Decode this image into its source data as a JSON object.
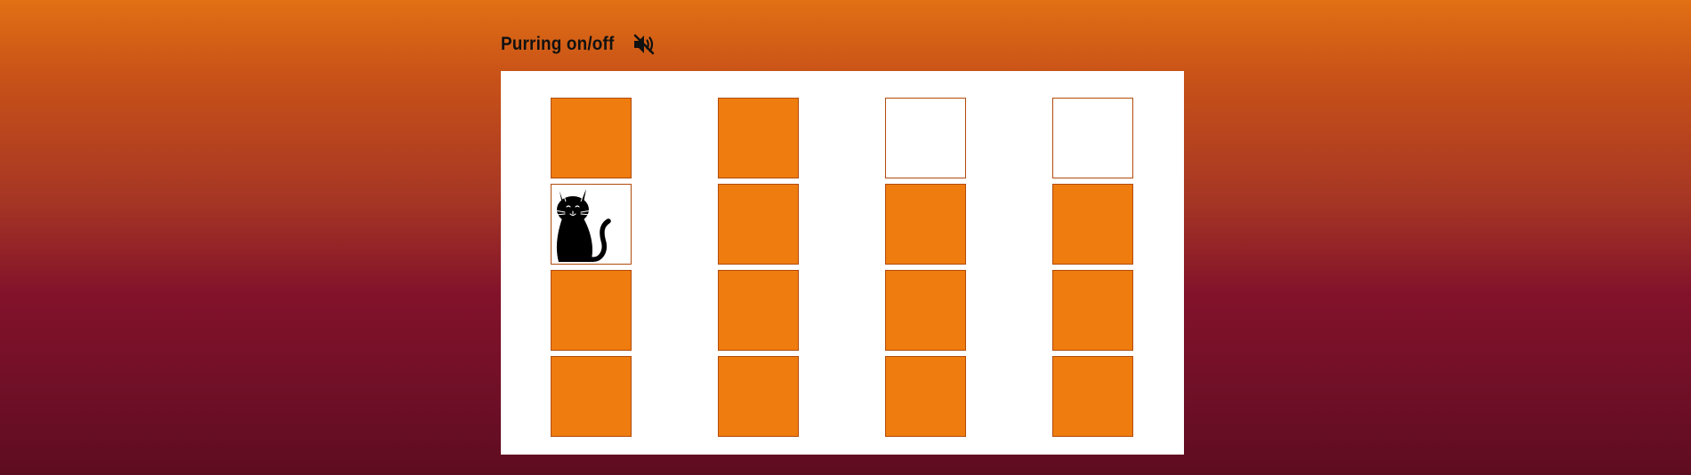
{
  "header": {
    "title": "Purring on/off",
    "sound_icon": "speaker-muted-icon",
    "sound_state": "off"
  },
  "colors": {
    "tile_fill": "#ef7c0e",
    "tile_border": "#b24b0a",
    "board_bg": "#ffffff",
    "cat": "#000000"
  },
  "board": {
    "columns": 4,
    "rows": 4,
    "tiles": [
      [
        "filled",
        "filled",
        "empty",
        "empty"
      ],
      [
        "cat",
        "filled",
        "filled",
        "filled"
      ],
      [
        "filled",
        "filled",
        "filled",
        "filled"
      ],
      [
        "filled",
        "filled",
        "filled",
        "filled"
      ]
    ],
    "cat_icon": "cat-icon"
  }
}
